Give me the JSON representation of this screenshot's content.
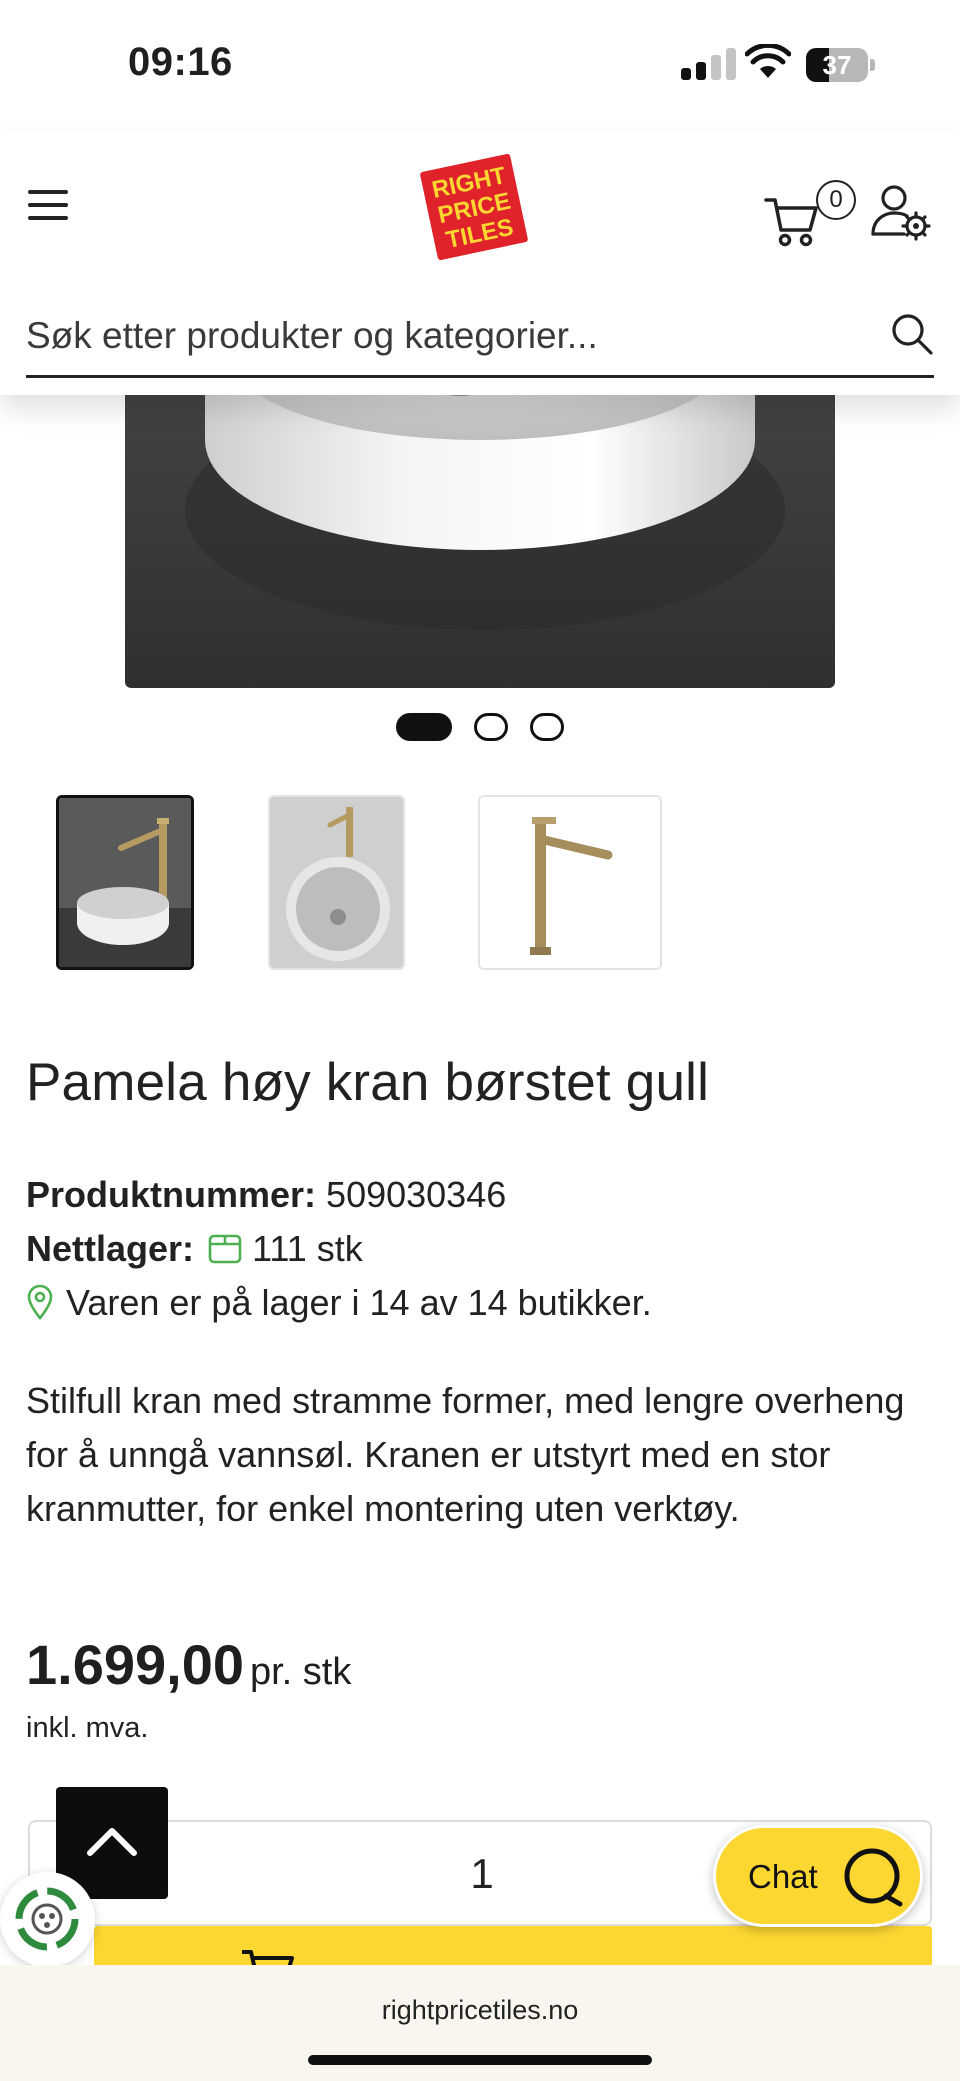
{
  "status_bar": {
    "time": "09:16",
    "battery": "37",
    "battery_level": 0.37
  },
  "header": {
    "logo_text": [
      "RIGHT",
      "PRICE",
      "TILES"
    ],
    "cart_count": "0",
    "search_placeholder": "Søk etter produkter og kategorier..."
  },
  "gallery": {
    "slide_count": 3,
    "active_slide": 1,
    "thumbnails": [
      "basin-with-tall-faucet",
      "basin-top-view",
      "tall-faucet"
    ]
  },
  "product": {
    "title": "Pamela høy kran børstet gull",
    "product_number_label": "Produktnummer:",
    "product_number": "509030346",
    "stock_label": "Nettlager:",
    "stock_value": "111 stk",
    "store_availability": "Varen er på lager i 14 av 14 butikker.",
    "description": "Stilfull kran med stramme former, med lengre overheng for å unngå vannsøl. Kranen er utstyrt med en stor kranmutter, for enkel montering uten verktøy.",
    "price": "1.699,00",
    "price_unit": "pr. stk",
    "vat_note": "inkl. mva.",
    "quantity": "1"
  },
  "chat": {
    "label": "Chat"
  },
  "browser": {
    "url": "rightpricetiles.no"
  },
  "colors": {
    "accent_yellow": "#fcd631",
    "logo_red": "#e0222b",
    "stock_green": "#4caf50",
    "text": "#222222"
  }
}
